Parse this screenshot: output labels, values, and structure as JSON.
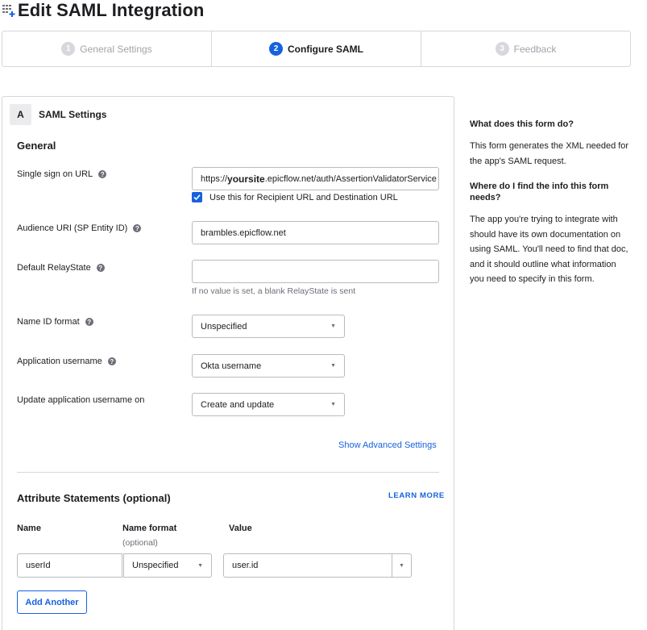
{
  "page": {
    "title": "Edit SAML Integration"
  },
  "wizard": {
    "steps": [
      {
        "num": "1",
        "label": "General Settings"
      },
      {
        "num": "2",
        "label": "Configure SAML"
      },
      {
        "num": "3",
        "label": "Feedback"
      }
    ],
    "active_step": "2"
  },
  "card": {
    "badge": "A",
    "title": "SAML Settings",
    "general_title": "General",
    "sso_url": {
      "label": "Single sign on URL",
      "prefix": "https://",
      "highlight": "yoursite",
      "suffix": ".epicflow.net/auth/AssertionValidatorService"
    },
    "recipient_checkbox": {
      "label": "Use this for Recipient URL and Destination URL",
      "checked": true
    },
    "audience_uri": {
      "label": "Audience URI (SP Entity ID)",
      "value": "brambles.epicflow.net"
    },
    "relay_state": {
      "label": "Default RelayState",
      "value": "",
      "hint": "If no value is set, a blank RelayState is sent"
    },
    "name_id_format": {
      "label": "Name ID format",
      "value": "Unspecified"
    },
    "app_username": {
      "label": "Application username",
      "value": "Okta username"
    },
    "update_username": {
      "label": "Update application username on",
      "value": "Create and update"
    },
    "advanced_link": "Show Advanced Settings",
    "attributes": {
      "title": "Attribute Statements (optional)",
      "learn_more": "LEARN MORE",
      "col_name": "Name",
      "col_format": "Name format",
      "col_format_sub": "(optional)",
      "col_value": "Value",
      "rows": [
        {
          "name": "userId",
          "format": "Unspecified",
          "value": "user.id"
        }
      ],
      "add_button": "Add Another"
    }
  },
  "aside": {
    "q1": "What does this form do?",
    "a1": "This form generates the XML needed for the app's SAML request.",
    "q2": "Where do I find the info this form needs?",
    "a2": "The app you're trying to integrate with should have its own documentation on using SAML. You'll need to find that doc, and it should outline what information you need to specify in this form."
  },
  "colors": {
    "accent": "#1662dd",
    "border": "#b7bcc0",
    "muted": "#6e6e78"
  },
  "icons": [
    "grid-add-icon",
    "help-icon",
    "checkmark-icon",
    "caret-down-icon"
  ]
}
